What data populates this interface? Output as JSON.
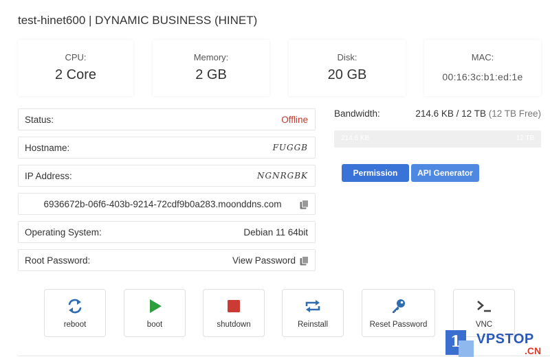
{
  "header": {
    "title": "test-hinet600 | DYNAMIC BUSINESS (HINET)"
  },
  "stats": {
    "cpu": {
      "label": "CPU:",
      "value": "2 Core"
    },
    "memory": {
      "label": "Memory:",
      "value": "2 GB"
    },
    "disk": {
      "label": "Disk:",
      "value": "20 GB"
    },
    "mac": {
      "label": "MAC:",
      "value": "00:16:3c:b1:ed:1e"
    }
  },
  "details": {
    "status": {
      "label": "Status:",
      "value": "Offline"
    },
    "hostname": {
      "label": "Hostname:",
      "value": "FUGGB"
    },
    "ip": {
      "label": "IP Address:",
      "value": "NGNRGBK"
    },
    "uuid": {
      "value": "6936672b-06f6-403b-9214-72cdf9b0a283.moonddns.com"
    },
    "os": {
      "label": "Operating System:",
      "value": "Debian 11 64bit"
    },
    "root_password": {
      "label": "Root Password:",
      "value": "View Password"
    }
  },
  "bandwidth": {
    "label": "Bandwidth:",
    "used": "214.6 KB / 12 TB",
    "free": "(12 TB Free)",
    "bar_left": "214.6 KB",
    "bar_right": "12 TB",
    "fraction_used": 0.0
  },
  "buttons": {
    "first": "Permission",
    "api": "API Generator"
  },
  "actions": [
    {
      "label": "reboot",
      "icon": "reboot-icon"
    },
    {
      "label": "boot",
      "icon": "play-icon"
    },
    {
      "label": "shutdown",
      "icon": "stop-icon"
    },
    {
      "label": "Reinstall",
      "icon": "reinstall-icon"
    },
    {
      "label": "Reset Password",
      "icon": "key-icon"
    },
    {
      "label": "VNC",
      "icon": "terminal-icon"
    }
  ],
  "watermark": {
    "number": "1",
    "brand": "VPSTOP",
    "suffix": ".CN"
  },
  "colors": {
    "primary": "#3a73d8",
    "offline": "#c0392b",
    "boot": "#2e9e3e",
    "shutdown": "#cc3b33",
    "action_icon": "#2f6db0"
  }
}
